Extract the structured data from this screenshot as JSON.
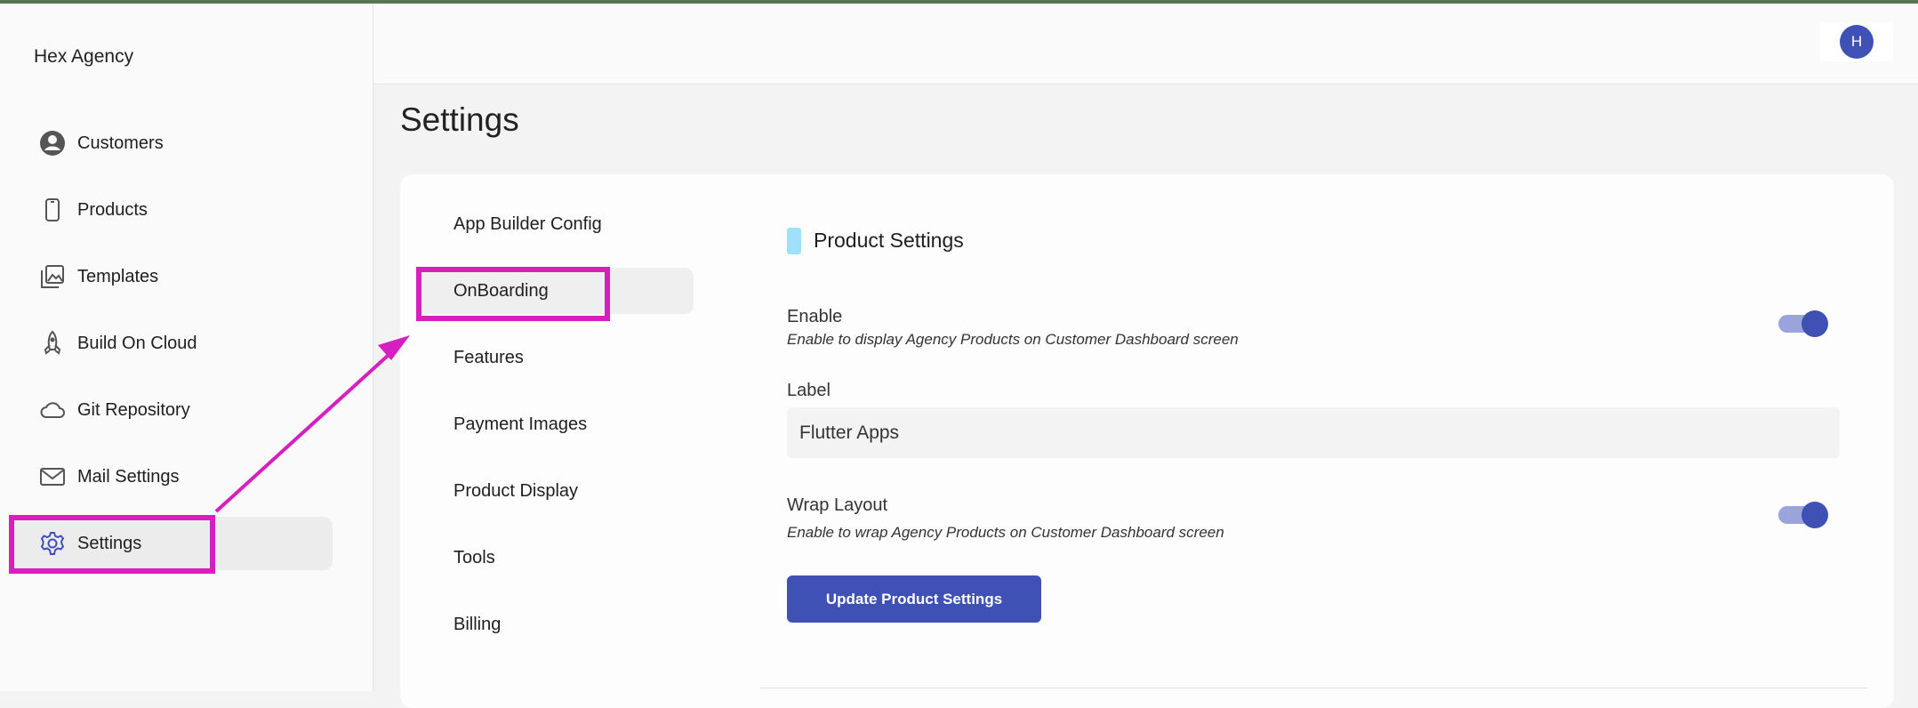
{
  "app": {
    "name": "Hex Agency"
  },
  "sidebar": {
    "items": [
      {
        "label": "Customers",
        "icon": "account-circle-icon",
        "active": false
      },
      {
        "label": "Products",
        "icon": "phone-icon",
        "active": false
      },
      {
        "label": "Templates",
        "icon": "templates-icon",
        "active": false
      },
      {
        "label": "Build On Cloud",
        "icon": "rocket-icon",
        "active": false
      },
      {
        "label": "Git Repository",
        "icon": "cloud-icon",
        "active": false
      },
      {
        "label": "Mail Settings",
        "icon": "mail-icon",
        "active": false
      },
      {
        "label": "Settings",
        "icon": "gear-icon",
        "active": true
      }
    ]
  },
  "header": {
    "avatar_initial": "H"
  },
  "page": {
    "title": "Settings"
  },
  "settings_tabs": [
    {
      "label": "App Builder Config",
      "active": false
    },
    {
      "label": "OnBoarding",
      "active": true
    },
    {
      "label": "Features",
      "active": false
    },
    {
      "label": "Payment Images",
      "active": false
    },
    {
      "label": "Product Display",
      "active": false
    },
    {
      "label": "Tools",
      "active": false
    },
    {
      "label": "Billing",
      "active": false
    }
  ],
  "product_settings": {
    "title": "Product Settings",
    "enable": {
      "label": "Enable",
      "hint": "Enable to display Agency Products on Customer Dashboard screen",
      "on": true
    },
    "label_field": {
      "label": "Label",
      "value": "Flutter Apps"
    },
    "wrap_layout": {
      "label": "Wrap Layout",
      "hint": "Enable to wrap Agency Products on Customer Dashboard screen",
      "on": true
    },
    "update_button": "Update Product Settings"
  },
  "colors": {
    "accent": "#3f51b5",
    "toggle_track": "#9aa3dc",
    "section_marker": "#9fe1fb",
    "annotation": "#d61fbf"
  }
}
